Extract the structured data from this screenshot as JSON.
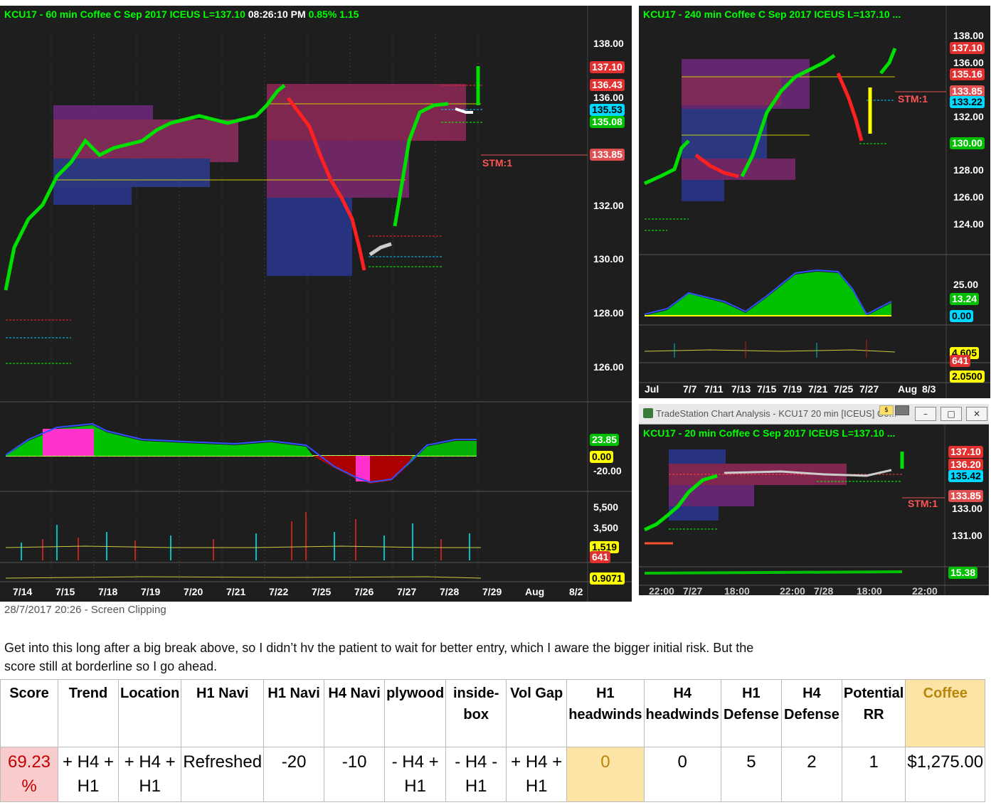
{
  "charts": {
    "main": {
      "title_green": "KCU17 - 60 min  Coffee C Sep 2017  ICEUS  L=137.10",
      "title_time": "08:26:10 PM",
      "title_pct": "0.85%  1.15",
      "price_ticks": [
        "138.00",
        "136.00",
        "132.00",
        "130.00",
        "128.00",
        "126.00"
      ],
      "badges": [
        "137.10",
        "136.43",
        "135.53",
        "135.08",
        "133.85"
      ],
      "stm": "STM:1",
      "osc_ticks": [
        "23.85",
        "0.00",
        "-20.00"
      ],
      "vol_ticks": [
        "5,500",
        "3,500",
        "1,519",
        "641"
      ],
      "bottom_tick": "0.9071",
      "x_labels": [
        "7/14",
        "7/15",
        "7/18",
        "7/19",
        "7/20",
        "7/21",
        "7/22",
        "7/25",
        "7/26",
        "7/27",
        "7/28",
        "7/29",
        "Aug",
        "8/2"
      ]
    },
    "h4": {
      "title": "KCU17 - 240 min  Coffee C Sep 2017  ICEUS  L=137.10  ...",
      "price_ticks": [
        "138.00",
        "136.00",
        "132.00",
        "128.00",
        "126.00",
        "124.00"
      ],
      "badges": [
        "137.10",
        "135.16",
        "133.85",
        "133.22",
        "130.00"
      ],
      "stm": "STM:1",
      "osc_ticks": [
        "25.00",
        "13.24",
        "0.00"
      ],
      "vol_ticks": [
        "4,605",
        "641",
        "2.0500"
      ],
      "x_labels": [
        "Jul",
        "7/7",
        "7/11",
        "7/13",
        "7/15",
        "7/19",
        "7/21",
        "7/25",
        "7/27",
        "Aug",
        "8/3"
      ]
    },
    "m20": {
      "window_title": "TradeStation Chart Analysis - KCU17 20 min [ICEUS] Co...",
      "title": "KCU17 - 20 min  Coffee C Sep 2017  ICEUS  L=137.10  ...",
      "price_ticks": [
        "133.00",
        "131.00"
      ],
      "badges": [
        "137.10",
        "136.20",
        "135.42",
        "133.85"
      ],
      "stm": "STM:1",
      "osc_tick": "15.38",
      "x_labels": [
        "22:00",
        "7/27",
        "18:00",
        "22:00",
        "7/28",
        "18:00",
        "22:00"
      ]
    }
  },
  "caption": "28/7/2017 20:26 - Screen Clipping",
  "note": "Get into this long after a big break above, so I didn’t hv the patient to wait for better entry, which I aware the bigger initial risk. But the score still at borderline so I go ahead.",
  "table": {
    "headers": [
      "Score",
      "Trend",
      "Location",
      "H1 Navi",
      "H1 Navi",
      "H4 Navi",
      "plywood",
      "inside-box",
      "Vol Gap",
      "H1 headwinds",
      "H4 headwinds",
      "H1 Defense",
      "H4 Defense",
      "Potential RR",
      "Coffee"
    ],
    "values": [
      "69.23 %",
      "+ H4 + H1",
      "+ H4 + H1",
      "Refreshed",
      "-20",
      "-10",
      "- H4 + H1",
      "- H4 - H1",
      "+ H4 + H1",
      "0",
      "0",
      "5",
      "2",
      "1",
      "$1,275.00"
    ]
  },
  "colors": {
    "chart_bg": "#1e1e1e",
    "up": "#00e000",
    "down": "#ff1a1a",
    "score_bg": "#f8cbcc",
    "highlight_bg": "#fce4a6",
    "badge_red": "#e03030",
    "badge_green": "#00c000",
    "badge_cyan": "#00d8ff",
    "badge_yellow": "#ffff00"
  }
}
